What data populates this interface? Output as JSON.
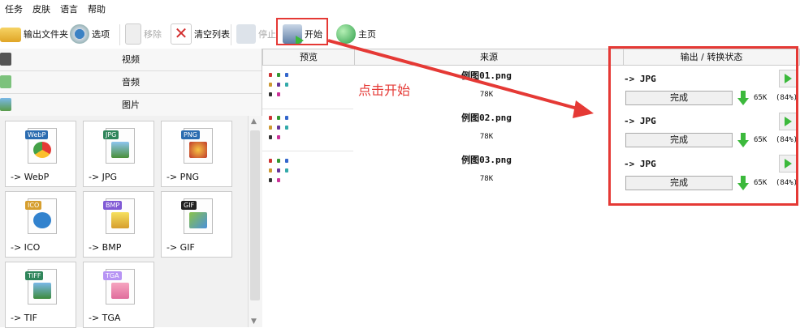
{
  "menu": [
    "任务",
    "皮肤",
    "语言",
    "帮助"
  ],
  "toolbar": {
    "output_folder": "输出文件夹",
    "options": "选项",
    "remove": "移除",
    "clear_list": "清空列表",
    "stop": "停止",
    "start": "开始",
    "home": "主页"
  },
  "categories": [
    "视频",
    "音频",
    "图片"
  ],
  "formats": [
    {
      "tag": "WebP",
      "label": "-> WebP",
      "color": "#2b6cb0"
    },
    {
      "tag": "JPG",
      "label": "-> JPG",
      "color": "#2f855a"
    },
    {
      "tag": "PNG",
      "label": "-> PNG",
      "color": "#2b6cb0"
    },
    {
      "tag": "ICO",
      "label": "-> ICO",
      "color": "#d69e2e"
    },
    {
      "tag": "BMP",
      "label": "-> BMP",
      "color": "#805ad5"
    },
    {
      "tag": "GIF",
      "label": "-> GIF",
      "color": "#222222"
    },
    {
      "tag": "TIFF",
      "label": "-> TIF",
      "color": "#2f855a"
    },
    {
      "tag": "TGA",
      "label": "-> TGA",
      "color": "#b794f4"
    }
  ],
  "table": {
    "headers": {
      "preview": "预览",
      "source": "来源",
      "output": "输出 / 转换状态"
    },
    "rows": [
      {
        "name": "例图01.png",
        "size": "78K",
        "format": "-> JPG",
        "status": "完成",
        "out_size": "65K",
        "ratio": "(84%)"
      },
      {
        "name": "例图02.png",
        "size": "78K",
        "format": "-> JPG",
        "status": "完成",
        "out_size": "65K",
        "ratio": "(84%)"
      },
      {
        "name": "例图03.png",
        "size": "78K",
        "format": "-> JPG",
        "status": "完成",
        "out_size": "65K",
        "ratio": "(84%)"
      }
    ]
  },
  "annotation": "点击开始",
  "colors": {
    "accent_red": "#e53935",
    "play_green": "#3cb93c"
  }
}
